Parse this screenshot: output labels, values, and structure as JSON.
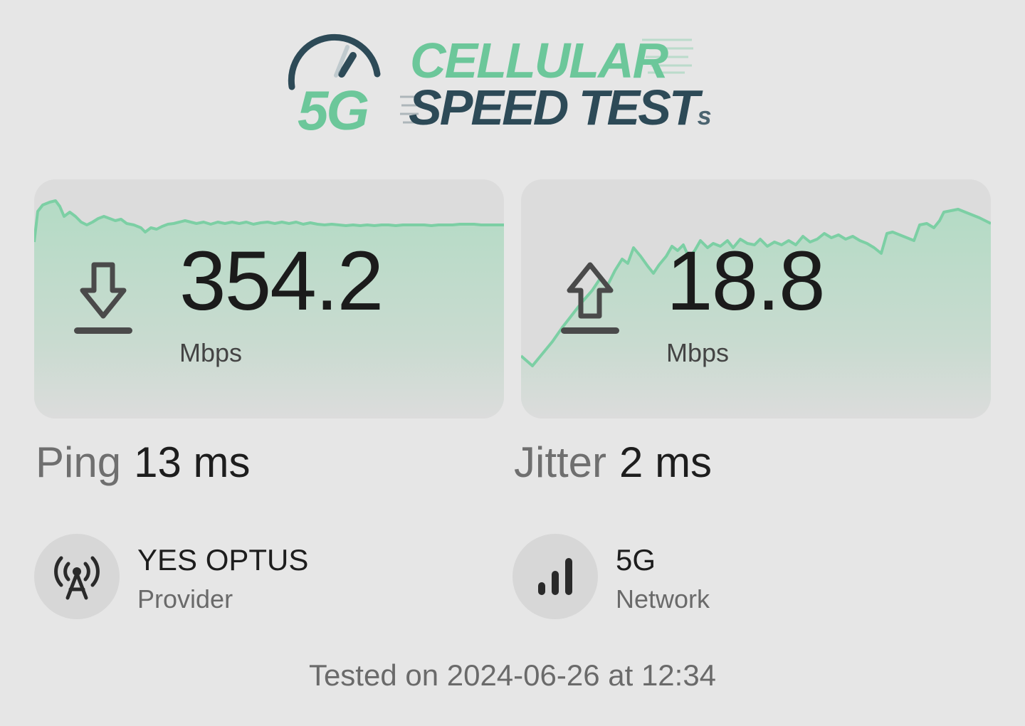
{
  "logo": {
    "badge": "5G",
    "line1": "CELLULAR",
    "line2": "SPEED TEST",
    "line2_suffix": "s",
    "colors": {
      "green": "#6cc79a",
      "dark": "#2d4a57"
    }
  },
  "download": {
    "icon": "download-arrow-icon",
    "value": "354.2",
    "unit": "Mbps"
  },
  "upload": {
    "icon": "upload-arrow-icon",
    "value": "18.8",
    "unit": "Mbps"
  },
  "ping": {
    "label": "Ping",
    "value": "13 ms"
  },
  "jitter": {
    "label": "Jitter",
    "value": "2 ms"
  },
  "provider": {
    "icon": "cell-tower-icon",
    "name": "YES OPTUS",
    "label": "Provider"
  },
  "network": {
    "icon": "signal-bars-icon",
    "name": "5G",
    "label": "Network"
  },
  "tested": "Tested on 2024-06-26 at 12:34",
  "colors": {
    "background": "#e6e6e6",
    "graph_line": "#7ccfa4",
    "graph_fill": "#b6dcc7"
  }
}
